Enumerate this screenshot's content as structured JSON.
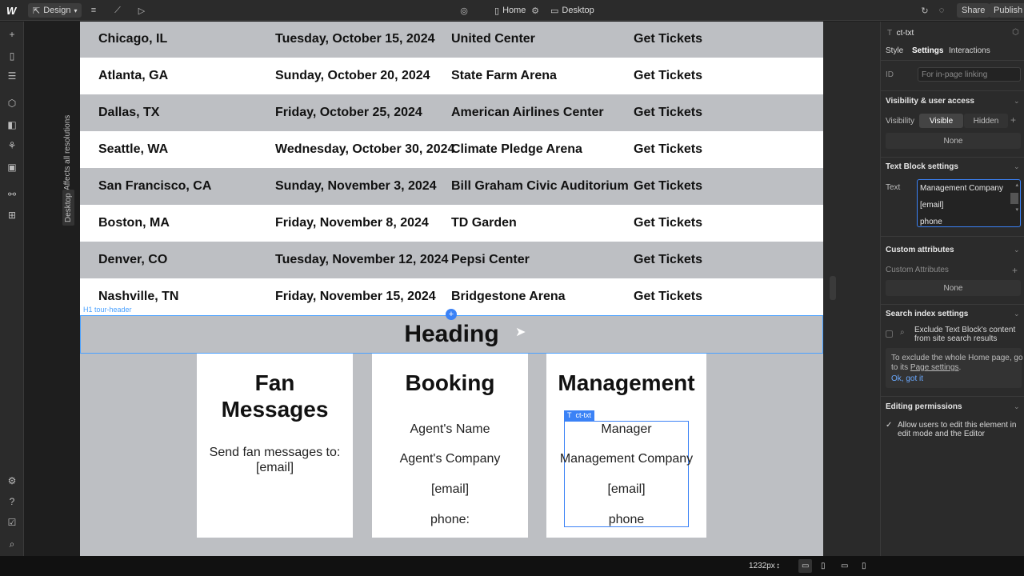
{
  "topbar": {
    "logo": "W",
    "mode": "Design",
    "page": "Home",
    "breakpoint": "Desktop",
    "share_label": "Share",
    "publish_label": "Publish"
  },
  "canvas": {
    "left_vertical_label": "Affects all resolutions",
    "breakpoint_badge": "Desktop",
    "tour_rows": [
      {
        "city": "Chicago, IL",
        "date": "Tuesday, October 15, 2024",
        "venue": "United Center",
        "action": "Get Tickets"
      },
      {
        "city": "Atlanta, GA",
        "date": "Sunday, October 20, 2024",
        "venue": "State Farm Arena",
        "action": "Get Tickets"
      },
      {
        "city": "Dallas, TX",
        "date": "Friday, October 25, 2024",
        "venue": "American Airlines Center",
        "action": "Get Tickets"
      },
      {
        "city": "Seattle, WA",
        "date": "Wednesday, October 30, 2024",
        "venue": "Climate Pledge Arena",
        "action": "Get Tickets"
      },
      {
        "city": "San Francisco, CA",
        "date": "Sunday, November 3, 2024",
        "venue": "Bill Graham Civic Auditorium",
        "action": "Get Tickets"
      },
      {
        "city": "Boston, MA",
        "date": "Friday, November 8, 2024",
        "venue": "TD Garden",
        "action": "Get Tickets"
      },
      {
        "city": "Denver, CO",
        "date": "Tuesday, November 12, 2024",
        "venue": "Pepsi Center",
        "action": "Get Tickets"
      },
      {
        "city": "Nashville, TN",
        "date": "Friday, November 15, 2024",
        "venue": "Bridgestone Arena",
        "action": "Get Tickets"
      }
    ],
    "heading_tag": "H1  tour-header",
    "heading": "Heading",
    "cards": {
      "fan": {
        "title_line1": "Fan",
        "title_line2": "Messages",
        "line1": "Send fan messages to:",
        "line2": "[email]"
      },
      "booking": {
        "title": "Booking",
        "lines": [
          "Agent's Name",
          "Agent's Company",
          "[email]",
          "phone:"
        ]
      },
      "management": {
        "title": "Management",
        "lines": [
          "Manager",
          "Management Company",
          "[email]",
          "phone"
        ],
        "selection_tag": "ct-txt"
      }
    }
  },
  "right_panel": {
    "element_name": "ct-txt",
    "tabs": [
      "Style",
      "Settings",
      "Interactions"
    ],
    "id_label": "ID",
    "id_placeholder": "For in-page linking",
    "visibility_section": "Visibility & user access",
    "visibility_label": "Visibility",
    "visible": "Visible",
    "hidden": "Hidden",
    "none1": "None",
    "text_block_section": "Text Block settings",
    "text_label": "Text",
    "text_lines": [
      "Management Company",
      "[email]",
      "phone"
    ],
    "custom_attr_section": "Custom attributes",
    "custom_attr_label": "Custom Attributes",
    "none2": "None",
    "search_section": "Search index settings",
    "exclude_line1": "Exclude Text Block's content",
    "exclude_line2": "from site search results",
    "info_line1": "To exclude the whole Home page, go",
    "info_line2_prefix": "to its ",
    "info_link": "Page settings",
    "info_line2_suffix": ".",
    "ok_link": "Ok, got it",
    "editing_section": "Editing permissions",
    "editing_line1": "Allow users to edit this element in",
    "editing_line2": "edit mode and the Editor"
  },
  "bottom": {
    "width_readout": "1232px"
  }
}
